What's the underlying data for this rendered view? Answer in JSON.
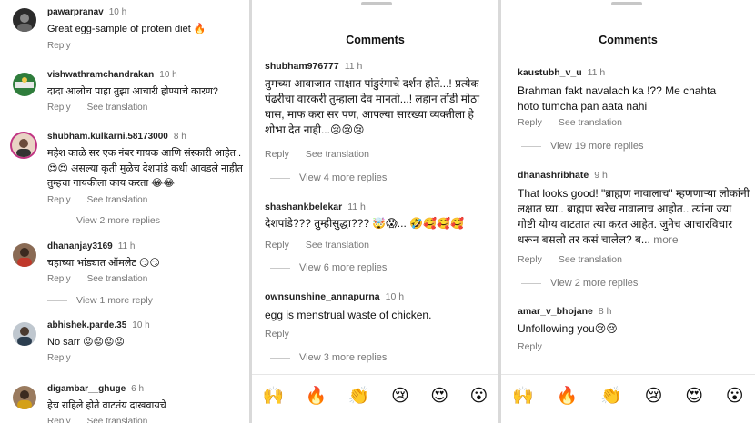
{
  "actions": {
    "reply": "Reply",
    "see_translation": "See translation"
  },
  "header_title": "Comments",
  "panel1": {
    "comments": [
      {
        "user": "pawarpranav",
        "time": "10 h",
        "text": "Great egg-sample of protein diet 🔥",
        "translation": false
      },
      {
        "user": "vishwathramchandrakan",
        "time": "10 h",
        "text": "दादा आलोच पाहा तुझा आचारी होण्याचे कारण?",
        "translation": true
      },
      {
        "user": "shubham.kulkarni.58173000",
        "time": "8 h",
        "text": "महेश काळे सर एक नंबर गायक आणि संस्कारी आहेत.. 😍😍 असल्या कृती मुळेच देशपांडे कधी आवडले नाहीत तुम्हचा गायकीला काय करता 😂😂",
        "translation": true,
        "view_more": "View 2 more replies"
      },
      {
        "user": "dhananjay3169",
        "time": "11 h",
        "text": "चहाच्या भांड्यात ऑमलेट 😏😏",
        "translation": true,
        "view_more": "View 1 more reply"
      },
      {
        "user": "abhishek.parde.35",
        "time": "10 h",
        "text": "No sarr 😡😡😡😡",
        "translation": false
      },
      {
        "user": "digambar__ghuge",
        "time": "6 h",
        "text": "हेच राहिले होते वाटतंय दाखवायचे",
        "translation": true
      }
    ]
  },
  "panel2": {
    "comments": [
      {
        "user": "shubham976777",
        "time": "11 h",
        "text": "तुमच्या आवाजात साक्षात पांडुरंगाचे दर्शन होते...! प्रत्येक पंढरीचा वारकरी तुम्हाला देव मानतो...! लहान तोंडी मोठा घास, माफ करा सर पण, आपल्या सारख्या व्यक्तीला हे शोभा देत नाही...😢😢😢",
        "translation": true,
        "view_more": "View 4 more replies"
      },
      {
        "user": "shashankbelekar",
        "time": "11 h",
        "text": "देशपांडे??? तुम्हीसुद्धा??? 🤯😱... 🤣🥰🥰🥰",
        "translation": true,
        "view_more": "View 6 more replies"
      },
      {
        "user": "ownsunshine_annapurna",
        "time": "10 h",
        "text": "egg is menstrual waste of chicken.",
        "translation": false,
        "view_more": "View 3 more replies"
      }
    ]
  },
  "panel3": {
    "comments": [
      {
        "user": "kaustubh_v_u",
        "time": "11 h",
        "text": "Brahman fakt navalach ka !?? Me chahta hoto tumcha pan aata nahi",
        "translation": true,
        "view_more": "View 19 more replies"
      },
      {
        "user": "dhanashribhate",
        "time": "9 h",
        "text": "That looks good! \"ब्राह्मण नावालाच\" म्हणणाऱ्या लोकांनी लक्षात घ्या.. ब्राह्मण खरेच नावालाच आहोत.. त्यांना ज्या गोष्टी योग्य वाटतात त्या करत आहेत. जुनेच आचारविचार धरून बसलो तर कसं चालेल? ब...",
        "more": "more",
        "translation": true,
        "view_more": "View 2 more replies"
      },
      {
        "user": "amar_v_bhojane",
        "time": "8 h",
        "text": "Unfollowing you😢😢",
        "translation": false
      }
    ]
  },
  "emoji_bar": [
    "🙌",
    "🔥",
    "👏",
    "😢",
    "😍",
    "😮"
  ],
  "colors": {
    "text": "#111111",
    "muted": "#777777",
    "divider": "#e3e3e3",
    "background": "#ffffff"
  }
}
